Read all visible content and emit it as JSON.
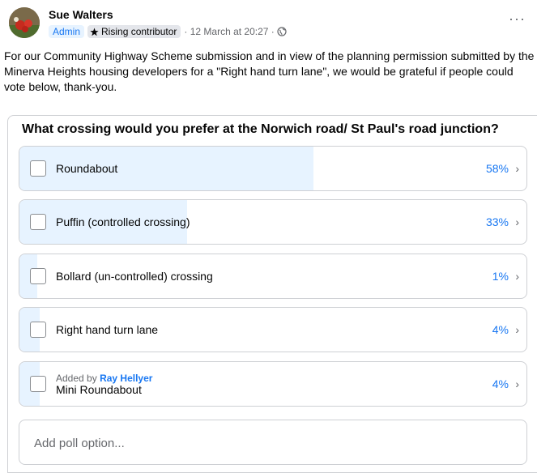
{
  "post": {
    "author": "Sue Walters",
    "badge_admin": "Admin",
    "badge_rising": "Rising contributor",
    "timestamp": "· 12 March at 20:27 ·",
    "more_label": "···",
    "body": "For our Community Highway Scheme submission and in view of the planning permission submitted by the Minerva Heights housing developers for a \"Right hand turn lane\", we would be grateful if people could vote below, thank-you."
  },
  "poll": {
    "question": "What crossing would you prefer at the Norwich road/ St Paul's road junction?",
    "options": [
      {
        "label": "Roundabout",
        "percent_text": "58%",
        "fraction": 0.58
      },
      {
        "label": "Puffin (controlled crossing)",
        "percent_text": "33%",
        "fraction": 0.33
      },
      {
        "label": "Bollard (un-controlled) crossing",
        "percent_text": "1%",
        "fraction": 0.01
      },
      {
        "label": "Right hand turn lane",
        "percent_text": "4%",
        "fraction": 0.04
      },
      {
        "label": "Mini Roundabout",
        "added_by_prefix": "Added by",
        "added_by_name": "Ray Hellyer",
        "percent_text": "4%",
        "fraction": 0.04
      }
    ],
    "chevron": "›",
    "add_option_placeholder": "Add poll option..."
  }
}
